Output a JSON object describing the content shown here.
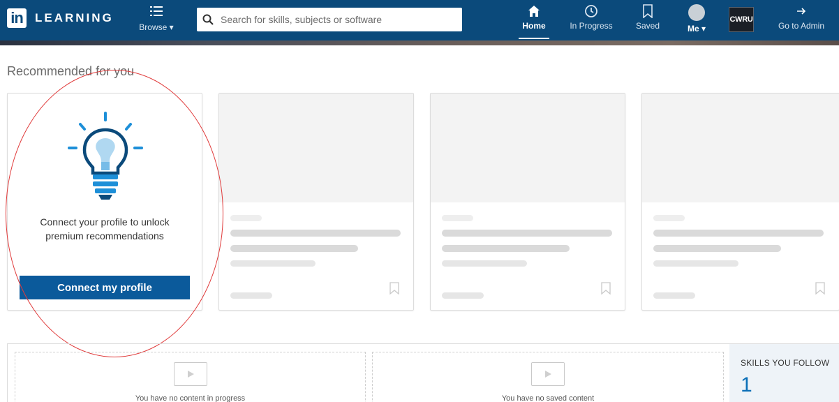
{
  "nav": {
    "logo_mark": "in",
    "logo_text": "LEARNING",
    "browse_label": "Browse",
    "search_placeholder": "Search for skills, subjects or software",
    "home_label": "Home",
    "in_progress_label": "In Progress",
    "saved_label": "Saved",
    "me_label": "Me",
    "org_label": "CWRU",
    "admin_label": "Go to Admin",
    "icons": [
      "menu-icon",
      "search-icon",
      "home-icon",
      "clock-icon",
      "bookmark-icon",
      "avatar",
      "caret-down-icon",
      "arrow-right-icon"
    ]
  },
  "recommended": {
    "title": "Recommended for you",
    "connect_text": "Connect your profile to unlock premium recommendations",
    "connect_button": "Connect my profile",
    "placeholder_cards": 3
  },
  "bottom": {
    "in_progress_empty": "You have no content in progress",
    "saved_empty": "You have no saved content",
    "skills_title": "SKILLS YOU FOLLOW",
    "skills_count": "1"
  },
  "colors": {
    "nav_bg": "#0b4a7b",
    "button_bg": "#0b5a9b",
    "bulb": "#1d8fd8",
    "bulb_dark": "#0b4a7b",
    "annotation": "#e03a3a",
    "skills_count": "#0b6fb8"
  }
}
